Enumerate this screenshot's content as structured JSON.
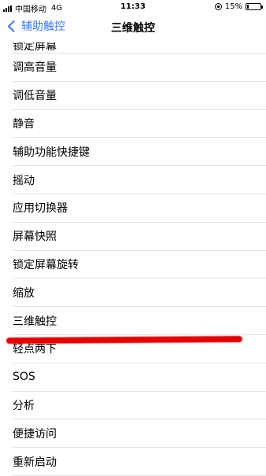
{
  "status_bar": {
    "carrier": "中国移动",
    "network": "4G",
    "time": "11:33",
    "battery_text": "15%",
    "battery_level": 0.15
  },
  "nav": {
    "back_label": "辅助触控",
    "title": "三维触控"
  },
  "list": {
    "items": [
      "锁定屏幕",
      "调高音量",
      "调低音量",
      "静音",
      "辅助功能快捷键",
      "摇动",
      "应用切换器",
      "屏幕快照",
      "锁定屏幕旋转",
      "缩放",
      "三维触控",
      "轻点两下",
      "SOS",
      "分析",
      "便捷访问",
      "重新启动"
    ]
  },
  "colors": {
    "accent": "#3478f6",
    "annotation": "#e60000"
  }
}
